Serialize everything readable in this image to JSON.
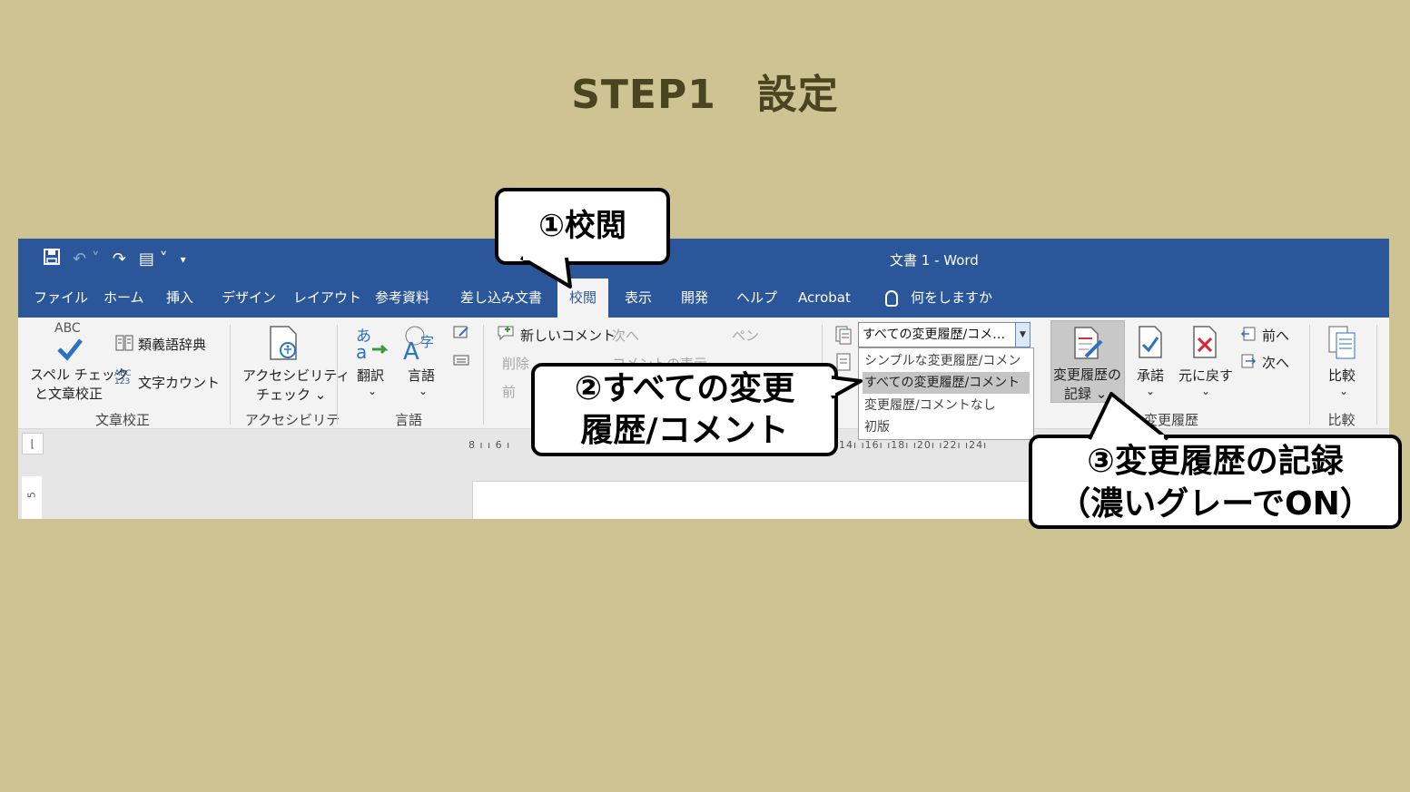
{
  "slide": {
    "title": "STEP1　設定"
  },
  "window": {
    "doc_title": "文書 1  -  Word"
  },
  "tabs": [
    "ファイル",
    "ホーム",
    "挿入",
    "デザイン",
    "レイアウト",
    "参考資料",
    "差し込み文書",
    "校閲",
    "表示",
    "開発",
    "ヘルプ",
    "Acrobat"
  ],
  "active_tab": "校閲",
  "tell_me": "何をしますか",
  "ribbon": {
    "proofing": {
      "spell_abc": "ABC",
      "spell_line1": "スペル チェック",
      "spell_line2": "と文章校正",
      "thesaurus": "類義語辞典",
      "word_count": "文字カウント",
      "abc123": "ABC\n123",
      "label": "文章校正"
    },
    "accessibility": {
      "line1": "アクセシビリティ",
      "line2": "チェック ⌄",
      "label": "アクセシビリティ"
    },
    "language": {
      "translate": "翻訳",
      "language": "言語",
      "chev": "⌄",
      "label": "言語"
    },
    "comments": {
      "new": "新しいコメント",
      "next": "次へ",
      "delete": "削除",
      "prev": "前",
      "show": "コメントの表示",
      "pen": "ペン"
    },
    "tracking": {
      "combo_value": "すべての変更履歴/コメ…",
      "options": [
        "シンプルな変更履歴/コメント",
        "すべての変更履歴/コメント",
        "変更履歴/コメントなし",
        "初版"
      ],
      "selected_index": 1,
      "record_line1": "変更履歴の",
      "record_line2": "記録 ⌄",
      "label": "変更履歴"
    },
    "changes": {
      "accept": "承諾",
      "reject": "元に戻す",
      "prev": "前へ",
      "next": "次へ",
      "chev": "⌄"
    },
    "compare": {
      "compare": "比較",
      "chev": "⌄",
      "label": "比較"
    }
  },
  "ruler": {
    "left_nums": "8 ı  ı 6 ı",
    "right_nums": "ı14ı  ı16ı  ı18ı  ı20ı  ı22ı  ı24ı",
    "vertical": "5"
  },
  "callouts": {
    "step1": "①校閲",
    "step2_line1": "②すべての変更",
    "step2_line2": "履歴/コメント",
    "step3_line1": "③変更履歴の記録",
    "step3_line2": "（濃いグレーでON）"
  },
  "colors": {
    "background": "#CDC393",
    "word_blue": "#2B579A",
    "record_on": "#C8C8C8",
    "title_text": "#4A4520"
  }
}
